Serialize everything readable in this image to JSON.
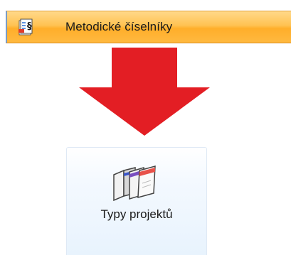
{
  "nav": {
    "label": "Metodické číselníky",
    "icon": "methodology-catalog-icon"
  },
  "tile": {
    "label": "Typy projektů",
    "icon": "project-types-folders-icon"
  },
  "colors": {
    "nav_highlight": "#ffb940",
    "arrow": "#e31e24",
    "tile_background": "#e8f3fd"
  }
}
